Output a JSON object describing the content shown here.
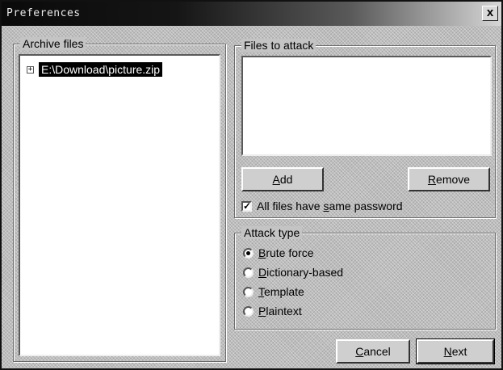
{
  "window": {
    "title": "Preferences",
    "close_glyph": "x"
  },
  "archive_group": {
    "label": "Archive files",
    "tree": [
      {
        "expander": "+",
        "label": "E:\\Download\\picture.zip",
        "selected": true
      }
    ]
  },
  "files_group": {
    "label": "Files to attack",
    "add": {
      "mnemonic": "A",
      "rest": "dd"
    },
    "remove": {
      "mnemonic": "R",
      "rest": "emove"
    },
    "same_password": {
      "checked": true,
      "check_glyph": "✓",
      "before": "All files have ",
      "mnemonic": "s",
      "after": "ame password"
    }
  },
  "attack_group": {
    "label": "Attack type",
    "options": [
      {
        "mnemonic": "B",
        "rest": "rute force",
        "selected": true
      },
      {
        "mnemonic": "D",
        "rest": "ictionary-based",
        "selected": false
      },
      {
        "mnemonic": "T",
        "rest": "emplate",
        "selected": false
      },
      {
        "mnemonic": "P",
        "rest": "laintext",
        "selected": false
      }
    ]
  },
  "buttons": {
    "cancel": {
      "mnemonic": "C",
      "rest": "ancel"
    },
    "next": {
      "mnemonic": "N",
      "rest": "ext"
    }
  }
}
